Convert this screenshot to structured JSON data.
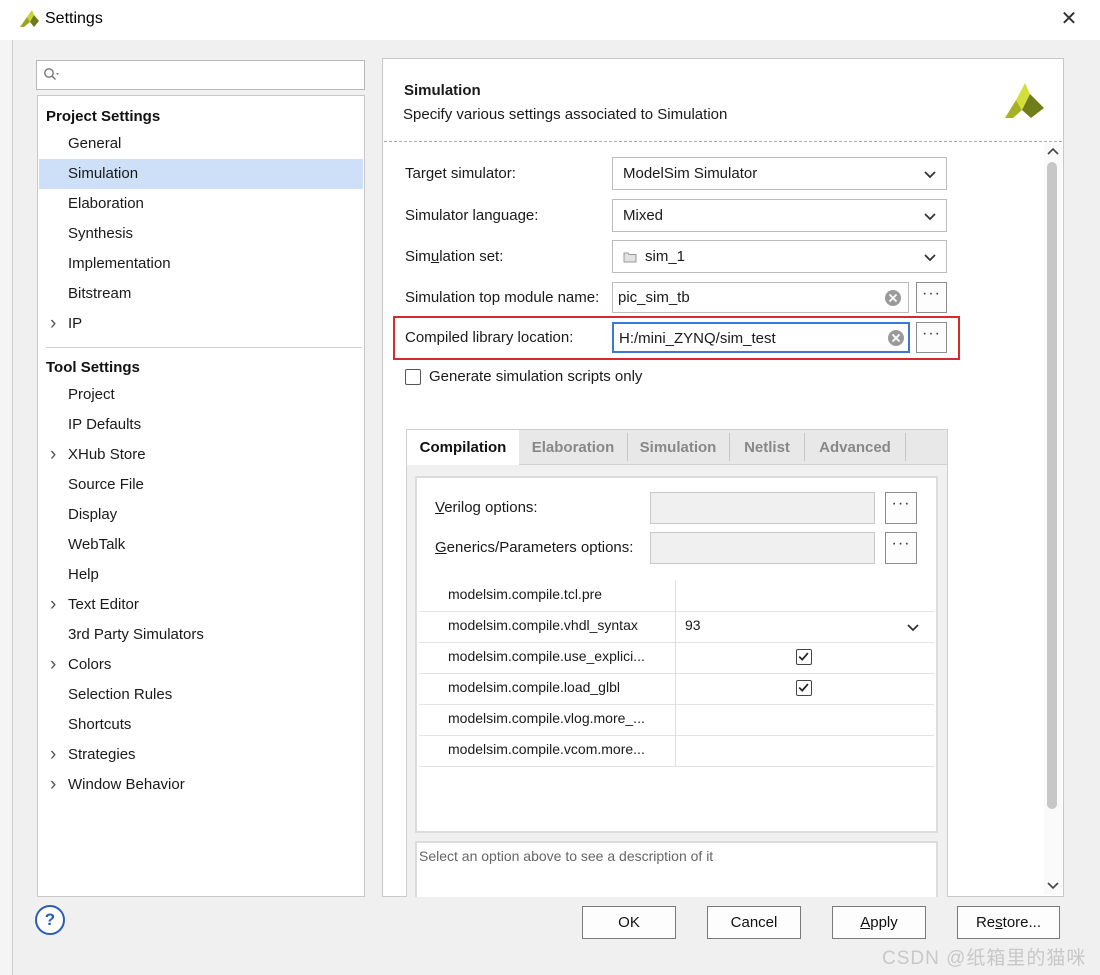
{
  "window": {
    "title": "Settings"
  },
  "search": {
    "placeholder": ""
  },
  "nav": {
    "project_heading": "Project Settings",
    "project_items": [
      {
        "label": "General",
        "chevron": false
      },
      {
        "label": "Simulation",
        "chevron": false,
        "selected": true
      },
      {
        "label": "Elaboration",
        "chevron": false
      },
      {
        "label": "Synthesis",
        "chevron": false
      },
      {
        "label": "Implementation",
        "chevron": false
      },
      {
        "label": "Bitstream",
        "chevron": false
      },
      {
        "label": "IP",
        "chevron": true
      }
    ],
    "tool_heading": "Tool Settings",
    "tool_items": [
      {
        "label": "Project",
        "chevron": false
      },
      {
        "label": "IP Defaults",
        "chevron": false
      },
      {
        "label": "XHub Store",
        "chevron": true
      },
      {
        "label": "Source File",
        "chevron": false
      },
      {
        "label": "Display",
        "chevron": false
      },
      {
        "label": "WebTalk",
        "chevron": false
      },
      {
        "label": "Help",
        "chevron": false
      },
      {
        "label": "Text Editor",
        "chevron": true
      },
      {
        "label": "3rd Party Simulators",
        "chevron": false
      },
      {
        "label": "Colors",
        "chevron": true
      },
      {
        "label": "Selection Rules",
        "chevron": false
      },
      {
        "label": "Shortcuts",
        "chevron": false
      },
      {
        "label": "Strategies",
        "chevron": true
      },
      {
        "label": "Window Behavior",
        "chevron": true
      }
    ]
  },
  "section": {
    "title": "Simulation",
    "description": "Specify various settings associated to Simulation"
  },
  "form": {
    "target_simulator_label": "Target simulator:",
    "target_simulator_value": "ModelSim Simulator",
    "sim_language_label": "Simulator language:",
    "sim_language_value": "Mixed",
    "sim_set_label_pre": "Sim",
    "sim_set_label_u": "u",
    "sim_set_label_post": "lation set:",
    "sim_set_value": "sim_1",
    "top_module_label": "Simulation top module name:",
    "top_module_value": "pic_sim_tb",
    "compiled_lib_label": "Compiled library location:",
    "compiled_lib_value": "H:/mini_ZYNQ/sim_test",
    "gen_scripts_label": "Generate simulation scripts only",
    "browse_label": "···"
  },
  "tabs": [
    "Compilation",
    "Elaboration",
    "Simulation",
    "Netlist",
    "Advanced"
  ],
  "compilation": {
    "verilog_label_u": "V",
    "verilog_label_rest": "erilog options:",
    "generics_label_u": "G",
    "generics_label_rest": "enerics/Parameters options:",
    "properties": [
      {
        "name": "modelsim.compile.tcl.pre",
        "value": ""
      },
      {
        "name": "modelsim.compile.vhdl_syntax",
        "value": "93"
      },
      {
        "name": "modelsim.compile.use_explici...",
        "value": ""
      },
      {
        "name": "modelsim.compile.load_glbl",
        "value": ""
      },
      {
        "name": "modelsim.compile.vlog.more_...",
        "value": ""
      },
      {
        "name": "modelsim.compile.vcom.more...",
        "value": ""
      }
    ],
    "description": "Select an option above to see a description of it"
  },
  "buttons": {
    "help": "?",
    "ok": "OK",
    "cancel": "Cancel",
    "apply_u": "A",
    "apply_rest": "pply",
    "restore_pre": "Re",
    "restore_u": "s",
    "restore_post": "tore..."
  },
  "watermark": "CSDN @纸箱里的猫咪",
  "colors": {
    "accent_border": "#d42b2b",
    "selection": "#cde0f7",
    "focus_border": "#3b78d8",
    "logo_green": "#7a8c1f"
  }
}
